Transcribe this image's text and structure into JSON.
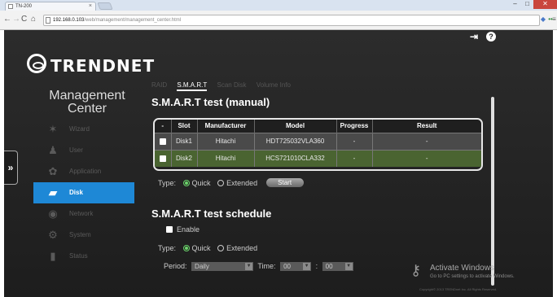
{
  "browser": {
    "tab_title": "TN-200",
    "tab_close": "×",
    "url_host": "192.168.0.103",
    "url_path": "/web/management/management_center.html",
    "window_controls": {
      "minimize": "–",
      "maximize": "□",
      "close": "✕"
    },
    "icons": [
      "back-icon",
      "forward-icon",
      "reload-icon",
      "home-icon",
      "star-icon",
      "extension-icon",
      "menu-icon"
    ]
  },
  "brand": {
    "logo_text": "TRENDNET"
  },
  "header": {
    "logout_icon": "⇥",
    "help_icon": "?"
  },
  "management": {
    "title_line1": "Management",
    "title_line2": "Center"
  },
  "sidebar": {
    "items": [
      {
        "label": "Wizard",
        "icon": "wand-icon"
      },
      {
        "label": "User",
        "icon": "user-icon"
      },
      {
        "label": "Application",
        "icon": "application-icon"
      },
      {
        "label": "Disk",
        "icon": "disk-icon",
        "active": true
      },
      {
        "label": "Network",
        "icon": "network-icon"
      },
      {
        "label": "System",
        "icon": "system-icon"
      },
      {
        "label": "Status",
        "icon": "status-icon"
      }
    ]
  },
  "expand_toggle": "»",
  "tabs": [
    {
      "label": "RAID"
    },
    {
      "label": "S.M.A.R.T",
      "active": true
    },
    {
      "label": "Scan Disk"
    },
    {
      "label": "Volume Info"
    }
  ],
  "smart_manual": {
    "title": "S.M.A.R.T test (manual)",
    "columns": [
      "-",
      "Slot",
      "Manufacturer",
      "Model",
      "Progress",
      "Result"
    ],
    "rows": [
      {
        "slot": "Disk1",
        "manufacturer": "Hitachi",
        "model": "HDT725032VLA360",
        "progress": "-",
        "result": "-"
      },
      {
        "slot": "Disk2",
        "manufacturer": "Hitachi",
        "model": "HCS721010CLA332",
        "progress": "-",
        "result": "-"
      }
    ],
    "type_label": "Type:",
    "quick_label": "Quick",
    "extended_label": "Extended",
    "selected_type": "Quick",
    "start_label": "Start"
  },
  "smart_schedule": {
    "title": "S.M.A.R.T test schedule",
    "enable_label": "Enable",
    "type_label": "Type:",
    "quick_label": "Quick",
    "extended_label": "Extended",
    "selected_type": "Quick",
    "period_label": "Period:",
    "period_value": "Daily",
    "time_label": "Time:",
    "hour_value": "00",
    "minute_value": "00",
    "time_separator": ":"
  },
  "watermark": {
    "title": "Activate Windows",
    "subtitle": "Go to PC settings to activate Windows."
  },
  "footer": {
    "copyright": "Copyright© 2013 TRENDnet Inc. All Rights Reserved."
  },
  "colors": {
    "accent": "#1e88d6",
    "page_bg": "#232323",
    "row_highlight": "#4a6431",
    "radio_on": "#6bd46b"
  }
}
